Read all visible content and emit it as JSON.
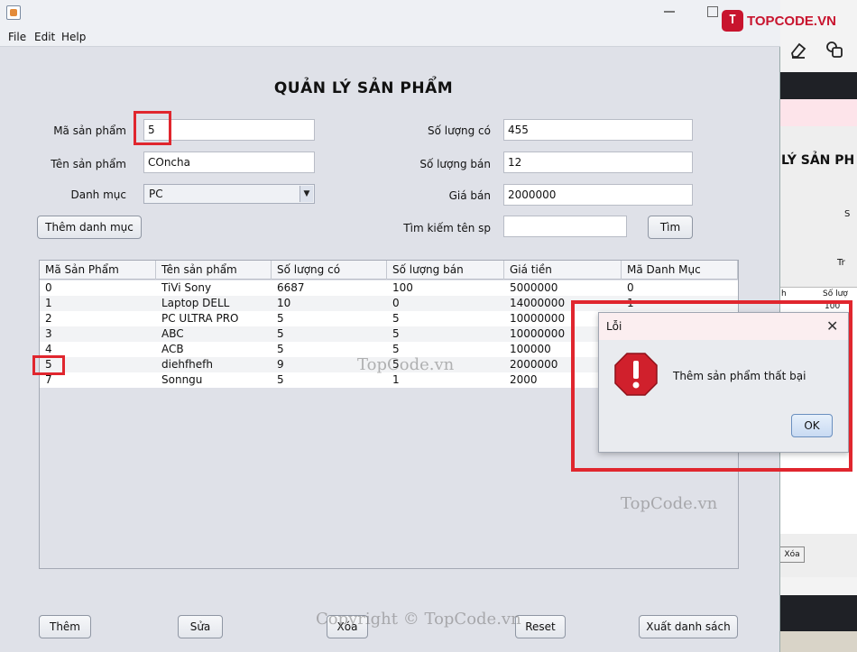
{
  "window": {
    "title": ""
  },
  "menu": [
    "File",
    "Edit",
    "Help"
  ],
  "heading": "QUẢN LÝ SẢN PHẨM",
  "form": {
    "ma_sp_label": "Mã sản phẩm",
    "ma_sp_value": "5",
    "ten_sp_label": "Tên sản phẩm",
    "ten_sp_value": "COncha",
    "danh_muc_label": "Danh mục",
    "danh_muc_value": "PC",
    "so_luong_co_label": "Số lượng có",
    "so_luong_co_value": "455",
    "so_luong_ban_label": "Số lượng bán",
    "so_luong_ban_value": "12",
    "gia_ban_label": "Giá bán",
    "gia_ban_value": "2000000",
    "tim_kiem_label": "Tìm kiếm tên sp",
    "tim_kiem_value": "",
    "them_danh_muc_button": "Thêm danh mục",
    "tim_button": "Tìm"
  },
  "table": {
    "columns": [
      "Mã Sản Phẩm",
      "Tên sản phẩm",
      "Số lượng có",
      "Số lượng bán",
      "Giá tiền",
      "Mã Danh Mục"
    ],
    "rows": [
      [
        "0",
        "TiVi Sony",
        "6687",
        "100",
        "5000000",
        "0"
      ],
      [
        "1",
        "Laptop DELL",
        "10",
        "0",
        "14000000",
        "1"
      ],
      [
        "2",
        "PC ULTRA PRO",
        "5",
        "5",
        "10000000",
        ""
      ],
      [
        "3",
        "ABC",
        "5",
        "5",
        "10000000",
        ""
      ],
      [
        "4",
        "ACB",
        "5",
        "5",
        "100000",
        ""
      ],
      [
        "5",
        "diehfhefh",
        "9",
        "5",
        "2000000",
        ""
      ],
      [
        "7",
        "Sonngu",
        "5",
        "1",
        "2000",
        ""
      ]
    ]
  },
  "buttons": {
    "them": "Thêm",
    "sua": "Sửa",
    "xoa": "Xóa",
    "reset": "Reset",
    "xuat": "Xuất danh sách"
  },
  "dialog": {
    "title": "Lỗi",
    "message": "Thêm sản phẩm thất bại",
    "ok": "OK",
    "icon": "error-stop-icon"
  },
  "background_window": {
    "title": "LÝ SẢN PH",
    "label1": "S",
    "label2": "Tr",
    "col1": "h",
    "col2": "Số lượ",
    "cell": "100",
    "button": "Xóa"
  },
  "watermarks": [
    "TopCode.vn",
    "TopCode.vn",
    "Copyright © TopCode.vn"
  ],
  "logo": {
    "text": "TOPCODE.VN",
    "mark": "T"
  },
  "colors": {
    "highlight": "#e0262e",
    "error_icon": "#d0202c",
    "window_bg": "#dfe1e8"
  }
}
